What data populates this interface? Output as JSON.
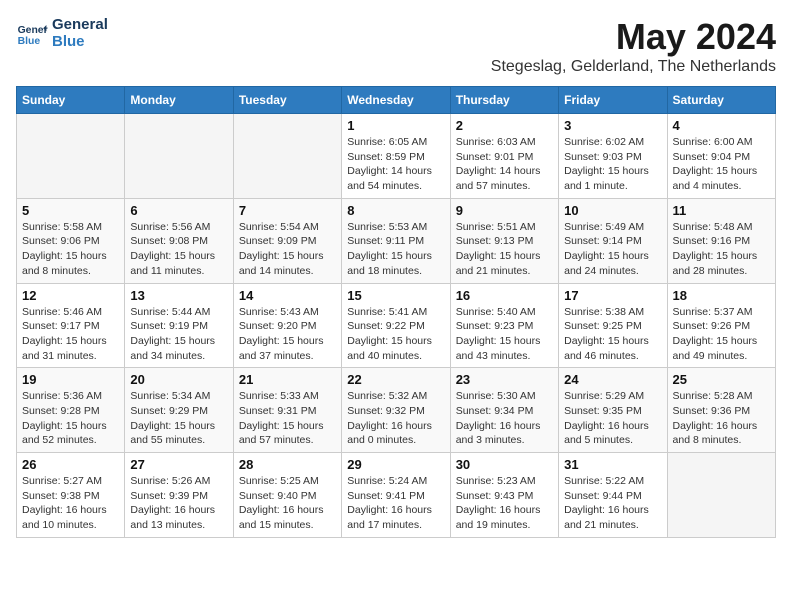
{
  "header": {
    "logo_line1": "General",
    "logo_line2": "Blue",
    "month_title": "May 2024",
    "subtitle": "Stegeslag, Gelderland, The Netherlands"
  },
  "days_of_week": [
    "Sunday",
    "Monday",
    "Tuesday",
    "Wednesday",
    "Thursday",
    "Friday",
    "Saturday"
  ],
  "weeks": [
    [
      {
        "day": "",
        "info": ""
      },
      {
        "day": "",
        "info": ""
      },
      {
        "day": "",
        "info": ""
      },
      {
        "day": "1",
        "info": "Sunrise: 6:05 AM\nSunset: 8:59 PM\nDaylight: 14 hours\nand 54 minutes."
      },
      {
        "day": "2",
        "info": "Sunrise: 6:03 AM\nSunset: 9:01 PM\nDaylight: 14 hours\nand 57 minutes."
      },
      {
        "day": "3",
        "info": "Sunrise: 6:02 AM\nSunset: 9:03 PM\nDaylight: 15 hours\nand 1 minute."
      },
      {
        "day": "4",
        "info": "Sunrise: 6:00 AM\nSunset: 9:04 PM\nDaylight: 15 hours\nand 4 minutes."
      }
    ],
    [
      {
        "day": "5",
        "info": "Sunrise: 5:58 AM\nSunset: 9:06 PM\nDaylight: 15 hours\nand 8 minutes."
      },
      {
        "day": "6",
        "info": "Sunrise: 5:56 AM\nSunset: 9:08 PM\nDaylight: 15 hours\nand 11 minutes."
      },
      {
        "day": "7",
        "info": "Sunrise: 5:54 AM\nSunset: 9:09 PM\nDaylight: 15 hours\nand 14 minutes."
      },
      {
        "day": "8",
        "info": "Sunrise: 5:53 AM\nSunset: 9:11 PM\nDaylight: 15 hours\nand 18 minutes."
      },
      {
        "day": "9",
        "info": "Sunrise: 5:51 AM\nSunset: 9:13 PM\nDaylight: 15 hours\nand 21 minutes."
      },
      {
        "day": "10",
        "info": "Sunrise: 5:49 AM\nSunset: 9:14 PM\nDaylight: 15 hours\nand 24 minutes."
      },
      {
        "day": "11",
        "info": "Sunrise: 5:48 AM\nSunset: 9:16 PM\nDaylight: 15 hours\nand 28 minutes."
      }
    ],
    [
      {
        "day": "12",
        "info": "Sunrise: 5:46 AM\nSunset: 9:17 PM\nDaylight: 15 hours\nand 31 minutes."
      },
      {
        "day": "13",
        "info": "Sunrise: 5:44 AM\nSunset: 9:19 PM\nDaylight: 15 hours\nand 34 minutes."
      },
      {
        "day": "14",
        "info": "Sunrise: 5:43 AM\nSunset: 9:20 PM\nDaylight: 15 hours\nand 37 minutes."
      },
      {
        "day": "15",
        "info": "Sunrise: 5:41 AM\nSunset: 9:22 PM\nDaylight: 15 hours\nand 40 minutes."
      },
      {
        "day": "16",
        "info": "Sunrise: 5:40 AM\nSunset: 9:23 PM\nDaylight: 15 hours\nand 43 minutes."
      },
      {
        "day": "17",
        "info": "Sunrise: 5:38 AM\nSunset: 9:25 PM\nDaylight: 15 hours\nand 46 minutes."
      },
      {
        "day": "18",
        "info": "Sunrise: 5:37 AM\nSunset: 9:26 PM\nDaylight: 15 hours\nand 49 minutes."
      }
    ],
    [
      {
        "day": "19",
        "info": "Sunrise: 5:36 AM\nSunset: 9:28 PM\nDaylight: 15 hours\nand 52 minutes."
      },
      {
        "day": "20",
        "info": "Sunrise: 5:34 AM\nSunset: 9:29 PM\nDaylight: 15 hours\nand 55 minutes."
      },
      {
        "day": "21",
        "info": "Sunrise: 5:33 AM\nSunset: 9:31 PM\nDaylight: 15 hours\nand 57 minutes."
      },
      {
        "day": "22",
        "info": "Sunrise: 5:32 AM\nSunset: 9:32 PM\nDaylight: 16 hours\nand 0 minutes."
      },
      {
        "day": "23",
        "info": "Sunrise: 5:30 AM\nSunset: 9:34 PM\nDaylight: 16 hours\nand 3 minutes."
      },
      {
        "day": "24",
        "info": "Sunrise: 5:29 AM\nSunset: 9:35 PM\nDaylight: 16 hours\nand 5 minutes."
      },
      {
        "day": "25",
        "info": "Sunrise: 5:28 AM\nSunset: 9:36 PM\nDaylight: 16 hours\nand 8 minutes."
      }
    ],
    [
      {
        "day": "26",
        "info": "Sunrise: 5:27 AM\nSunset: 9:38 PM\nDaylight: 16 hours\nand 10 minutes."
      },
      {
        "day": "27",
        "info": "Sunrise: 5:26 AM\nSunset: 9:39 PM\nDaylight: 16 hours\nand 13 minutes."
      },
      {
        "day": "28",
        "info": "Sunrise: 5:25 AM\nSunset: 9:40 PM\nDaylight: 16 hours\nand 15 minutes."
      },
      {
        "day": "29",
        "info": "Sunrise: 5:24 AM\nSunset: 9:41 PM\nDaylight: 16 hours\nand 17 minutes."
      },
      {
        "day": "30",
        "info": "Sunrise: 5:23 AM\nSunset: 9:43 PM\nDaylight: 16 hours\nand 19 minutes."
      },
      {
        "day": "31",
        "info": "Sunrise: 5:22 AM\nSunset: 9:44 PM\nDaylight: 16 hours\nand 21 minutes."
      },
      {
        "day": "",
        "info": ""
      }
    ]
  ]
}
